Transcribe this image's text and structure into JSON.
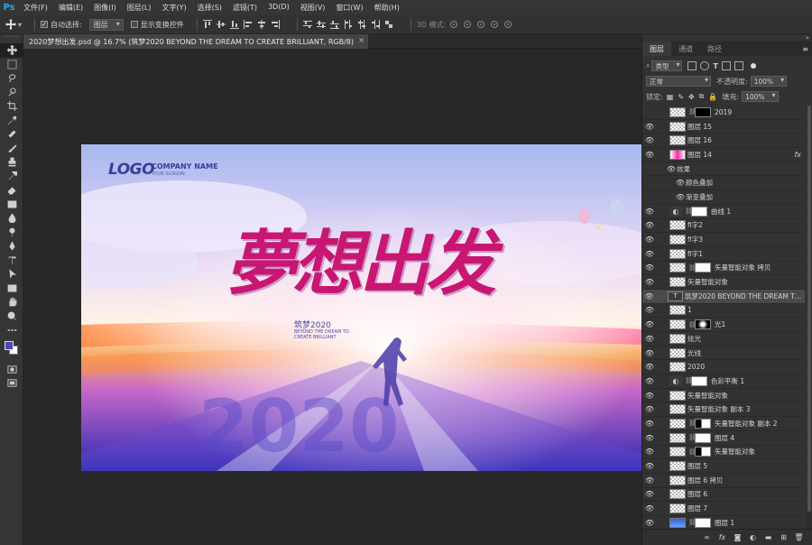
{
  "app": {
    "logo": "Ps"
  },
  "menu": [
    "文件(F)",
    "编辑(E)",
    "图像(I)",
    "图层(L)",
    "文字(Y)",
    "选择(S)",
    "滤镜(T)",
    "3D(D)",
    "视图(V)",
    "窗口(W)",
    "帮助(H)"
  ],
  "options": {
    "auto_select_label": "自动选择:",
    "auto_select_value": "图层",
    "show_transform_label": "显示变换控件",
    "mode_3d_label": "3D 模式:"
  },
  "document": {
    "tab_title": "2020梦想出发.psd @ 16.7% (筑梦2020 BEYOND THE DREAM TO  CREATE BRILLIANT, RGB/8)",
    "close": "×"
  },
  "artwork": {
    "logo": "LOGO",
    "company": "COMPANY NAME",
    "slogan": "YOUR SLOGON",
    "title": "夢想出发",
    "sub_title": "筑梦2020",
    "sub_line1": "BEYOND THE DREAM TO",
    "sub_line2": "CREATE BRILLIANT",
    "big_year": "2020"
  },
  "panel": {
    "tabs": [
      "图层",
      "通道",
      "路径"
    ],
    "filter_kind": "类型",
    "blend_mode": "正常",
    "opacity_label": "不透明度:",
    "opacity_value": "100%",
    "lock_label": "锁定:",
    "fill_label": "填充:",
    "fill_value": "100%"
  },
  "layers": [
    {
      "name": "2019",
      "visible": false,
      "thumb": "checker",
      "mask": "black",
      "link": true
    },
    {
      "name": "图层 15",
      "visible": true,
      "thumb": "checker"
    },
    {
      "name": "图层 16",
      "visible": true,
      "thumb": "checker"
    },
    {
      "name": "图层 14",
      "visible": true,
      "thumb": "pink",
      "fx": "fx"
    },
    {
      "name": "效果",
      "effect": true,
      "level": 0
    },
    {
      "name": "颜色叠加",
      "effect": true,
      "level": 1
    },
    {
      "name": "渐变叠加",
      "effect": true,
      "level": 1
    },
    {
      "name": "曲线 1",
      "visible": true,
      "thumb": "adjust",
      "mask": "white",
      "link": true
    },
    {
      "name": "fi字2",
      "visible": true,
      "thumb": "checker"
    },
    {
      "name": "fi字3",
      "visible": true,
      "thumb": "checker"
    },
    {
      "name": "fi字1",
      "visible": true,
      "thumb": "checker"
    },
    {
      "name": "矢量智能对象 拷贝",
      "visible": true,
      "thumb": "smart",
      "mask": "white",
      "link": true
    },
    {
      "name": "矢量智能对象",
      "visible": true,
      "thumb": "smart"
    },
    {
      "name": "筑梦2020 BEYOND THE DREAM TO  C...",
      "visible": true,
      "thumb": "text",
      "selected": true
    },
    {
      "name": "1",
      "visible": true,
      "thumb": "checker"
    },
    {
      "name": "光1",
      "visible": true,
      "thumb": "checker",
      "mask": "spot",
      "link": true
    },
    {
      "name": "炫光",
      "visible": true,
      "thumb": "checker"
    },
    {
      "name": "光线",
      "visible": true,
      "thumb": "checker"
    },
    {
      "name": "2020",
      "visible": true,
      "thumb": "checker"
    },
    {
      "name": "色彩平衡 1",
      "visible": true,
      "thumb": "adjust",
      "mask": "white",
      "link": true
    },
    {
      "name": "矢量智能对象",
      "visible": true,
      "thumb": "checker"
    },
    {
      "name": "矢量智能对象 副本 3",
      "visible": true,
      "thumb": "checker"
    },
    {
      "name": "矢量智能对象 副本 2",
      "visible": true,
      "thumb": "checker",
      "mask": "dark",
      "link": true
    },
    {
      "name": "图层 4",
      "visible": true,
      "thumb": "checker",
      "mask": "white",
      "link": true
    },
    {
      "name": "矢量智能对象",
      "visible": true,
      "thumb": "smart",
      "mask": "dark",
      "link": true
    },
    {
      "name": "图层 5",
      "visible": true,
      "thumb": "checker"
    },
    {
      "name": "图层 6 拷贝",
      "visible": true,
      "thumb": "checker"
    },
    {
      "name": "图层 6",
      "visible": true,
      "thumb": "checker"
    },
    {
      "name": "图层 7",
      "visible": true,
      "thumb": "checker"
    },
    {
      "name": "图层 1",
      "visible": true,
      "thumb": "blue",
      "mask": "white",
      "link": true
    }
  ],
  "colors": {
    "foreground": "#4848b8",
    "background": "#ffffff",
    "accent": "#2fa3f0"
  }
}
